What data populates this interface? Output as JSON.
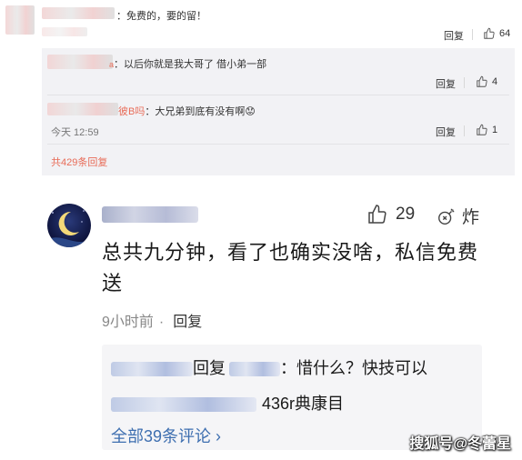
{
  "top": {
    "comment_main": {
      "text": "：免费的，要的留！",
      "reply_label": "回复",
      "like_count": "64"
    },
    "replies": [
      {
        "text": "：以后你就是我大哥了  借小弟一部",
        "name_tail": "a",
        "reply_label": "回复",
        "like_count": "4"
      },
      {
        "name_tail": "彼B吗",
        "text": "：大兄弟到底有没有啊",
        "emoji": "😟",
        "time": "今天 12:59",
        "reply_label": "回复",
        "like_count": "1"
      }
    ],
    "total_replies": "共429条回复"
  },
  "bottom": {
    "like_count": "29",
    "bomb_label": "炸",
    "comment_text": "总共九分钟，看了也确实没啥，私信免费送",
    "time": "9小时前",
    "reply_label": "回复",
    "reply_box": {
      "line1_text": "回复",
      "line1_body": "：惜什么？快技可以",
      "line2_body": "436r典康目",
      "all_comments": "全部39条评论 ›"
    },
    "watermark": "搜狐号@冬蕾星"
  },
  "colors": {
    "link_blue": "#3e6fb0",
    "red_link": "#e86c58",
    "gray_bg": "#f2f2f5"
  }
}
